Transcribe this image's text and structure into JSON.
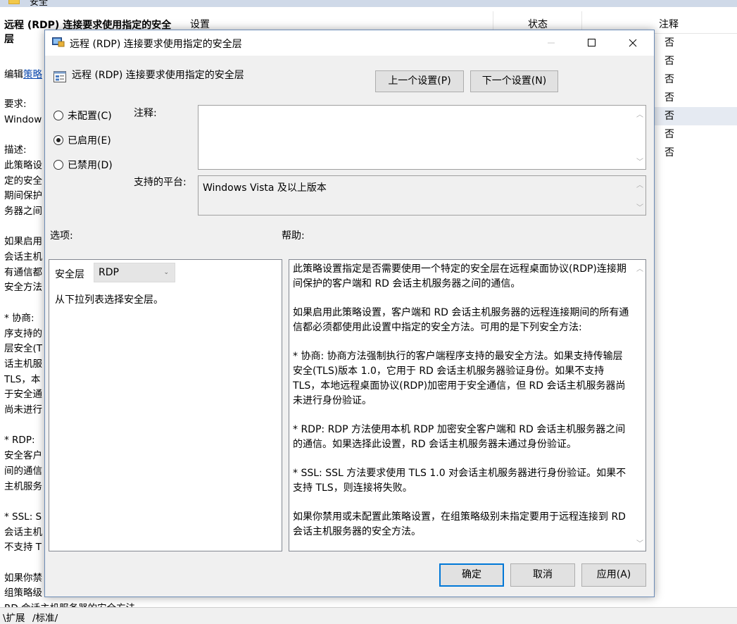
{
  "background": {
    "folder_title": "安全",
    "policy_title": "远程 (RDP) 连接要求使用指定的安全层",
    "edit_prefix": "编辑",
    "edit_link": "策略",
    "left_lines": [
      "要求:",
      "Window",
      "",
      "描述:",
      "此策略设",
      "定的安全",
      "期间保护",
      "务器之间",
      "",
      "如果启用",
      "会话主机",
      "有通信都",
      "安全方法",
      "",
      " * 协商:",
      "序支持的",
      "层安全(T",
      "话主机服",
      "TLS，本",
      "于安全通",
      "尚未进行",
      "",
      " * RDP:",
      "安全客户",
      "间的通信",
      "主机服务",
      "",
      " * SSL: S",
      "会话主机",
      "不支持 T",
      "",
      "如果你禁",
      "组策略级",
      "RD 会话主机服务器的安全方法。"
    ],
    "columns": {
      "setting": "设置",
      "state": "状态",
      "note": "注释"
    },
    "note_values": [
      "否",
      "否",
      "否",
      "否",
      "否",
      "否",
      "否"
    ],
    "tabs": [
      "扩展",
      "标准"
    ]
  },
  "dialog": {
    "title": "远程 (RDP) 连接要求使用指定的安全层",
    "heading": "远程 (RDP) 连接要求使用指定的安全层",
    "prev_button": "上一个设置(P)",
    "next_button": "下一个设置(N)",
    "radios": [
      {
        "label": "未配置(C)",
        "checked": false
      },
      {
        "label": "已启用(E)",
        "checked": true
      },
      {
        "label": "已禁用(D)",
        "checked": false
      }
    ],
    "comment_label": "注释:",
    "comment_value": "",
    "platform_label": "支持的平台:",
    "platform_value": "Windows Vista 及以上版本",
    "options_label": "选项:",
    "help_label": "帮助:",
    "security_layer_label": "安全层",
    "security_layer_value": "RDP",
    "options_desc": "从下拉列表选择安全层。",
    "help_paragraphs": [
      "此策略设置指定是否需要使用一个特定的安全层在远程桌面协议(RDP)连接期间保护的客户端和 RD 会话主机服务器之间的通信。",
      "如果启用此策略设置，客户端和 RD 会话主机服务器的远程连接期间的所有通信都必须都使用此设置中指定的安全方法。可用的是下列安全方法:",
      " * 协商: 协商方法强制执行的客户端程序支持的最安全方法。如果支持传输层安全(TLS)版本 1.0，它用于 RD 会话主机服务器验证身份。如果不支持 TLS，本地远程桌面协议(RDP)加密用于安全通信，但 RD 会话主机服务器尚未进行身份验证。",
      " * RDP: RDP 方法使用本机 RDP 加密安全客户端和 RD 会话主机服务器之间的通信。如果选择此设置，RD 会话主机服务器未通过身份验证。",
      " * SSL: SSL 方法要求使用 TLS 1.0 对会话主机服务器进行身份验证。如果不支持 TLS，则连接将失败。",
      "如果你禁用或未配置此策略设置，在组策略级别未指定要用于远程连接到 RD 会话主机服务器的安全方法。"
    ],
    "ok_button": "确定",
    "cancel_button": "取消",
    "apply_button": "应用(A)"
  }
}
